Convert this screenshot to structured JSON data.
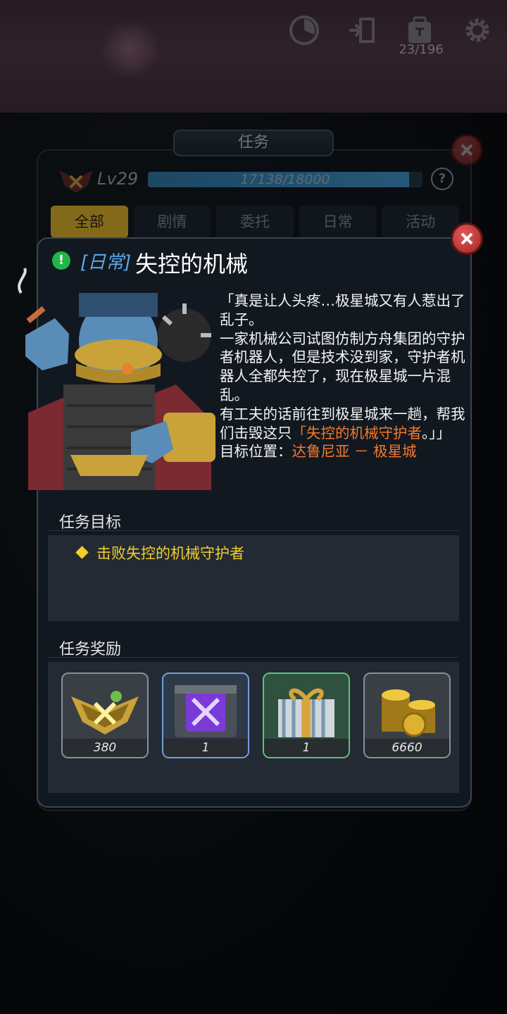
{
  "hud": {
    "buttons": [
      {
        "icon": "radar-icon"
      },
      {
        "icon": "exit-door-icon"
      },
      {
        "icon": "inventory-bag-icon"
      },
      {
        "icon": "gear-icon"
      }
    ],
    "inventory_count": "23/196"
  },
  "quest_list": {
    "title": "任务",
    "level": "Lv29",
    "exp_text": "17138/18000",
    "exp_progress": 0.952,
    "help": "?",
    "tabs": [
      "全部",
      "剧情",
      "委托",
      "日常",
      "活动"
    ],
    "active_tab": "全部"
  },
  "quest_detail": {
    "type_tag": "[日常]",
    "title": "失控的机械",
    "story": {
      "p1": "「真是让人头疼…极星城又有人惹出了乱子。",
      "p2": "一家机械公司试图仿制方舟集团的守护者机器人，但是技术没到家，守护者机器人全都失控了，现在极星城一片混乱。",
      "p3_prefix": "有工夫的话前往到极星城来一趟，帮我们击毁这只",
      "p3_highlight": "「失控的机械守护者",
      "p3_suffix": "。」」",
      "location_label": "目标位置：",
      "location_value": "达鲁尼亚 － 极星城"
    },
    "objective_heading": "任务目标",
    "objective": "击败失控的机械守护者",
    "reward_heading": "任务奖励",
    "rewards": [
      {
        "icon": "exp-medal-icon",
        "qty": "380"
      },
      {
        "icon": "purple-crate-icon",
        "qty": "1"
      },
      {
        "icon": "gift-box-icon",
        "qty": "1"
      },
      {
        "icon": "gold-coins-icon",
        "qty": "6660"
      }
    ]
  },
  "colors": {
    "active_tab": "#c9a32a",
    "highlight": "#f4792b",
    "objective": "#f2cf2a",
    "type_tag": "#5aa6e8",
    "close": "#c43030"
  }
}
